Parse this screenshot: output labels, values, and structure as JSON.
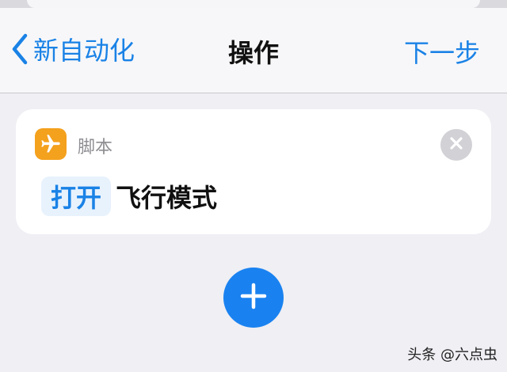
{
  "navbar": {
    "back_label": "新自动化",
    "title": "操作",
    "next_label": "下一步"
  },
  "action_card": {
    "icon": "airplane-icon",
    "icon_color": "#f4a11e",
    "category": "脚本",
    "parameter": "打开",
    "action": "飞行模式"
  },
  "accent_color": "#1a82e6",
  "watermark": "头条 @六点虫"
}
